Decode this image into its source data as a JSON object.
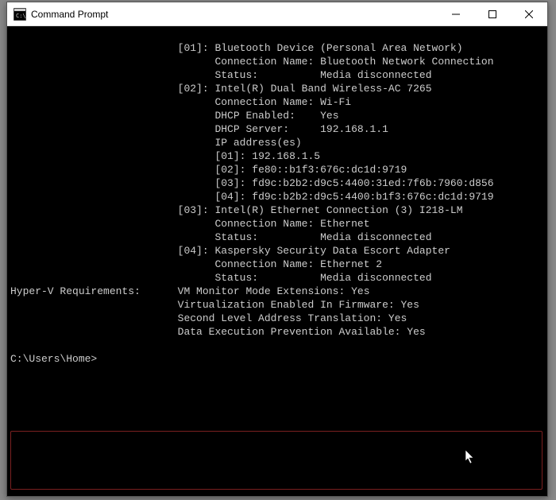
{
  "window": {
    "title": "Command Prompt"
  },
  "net01": {
    "label": "[01]:",
    "name": "Bluetooth Device (Personal Area Network)",
    "conn_label": "Connection Name:",
    "conn_value": "Bluetooth Network Connection",
    "status_label": "Status:",
    "status_value": "Media disconnected"
  },
  "net02": {
    "label": "[02]:",
    "name": "Intel(R) Dual Band Wireless-AC 7265",
    "conn_label": "Connection Name:",
    "conn_value": "Wi-Fi",
    "dhcp_enabled_label": "DHCP Enabled:",
    "dhcp_enabled_value": "Yes",
    "dhcp_server_label": "DHCP Server:",
    "dhcp_server_value": "192.168.1.1",
    "ip_label": "IP address(es)",
    "ip01_label": "[01]:",
    "ip01_value": "192.168.1.5",
    "ip02_label": "[02]:",
    "ip02_value": "fe80::b1f3:676c:dc1d:9719",
    "ip03_label": "[03]:",
    "ip03_value": "fd9c:b2b2:d9c5:4400:31ed:7f6b:7960:d856",
    "ip04_label": "[04]:",
    "ip04_value": "fd9c:b2b2:d9c5:4400:b1f3:676c:dc1d:9719"
  },
  "net03": {
    "label": "[03]:",
    "name": "Intel(R) Ethernet Connection (3) I218-LM",
    "conn_label": "Connection Name:",
    "conn_value": "Ethernet",
    "status_label": "Status:",
    "status_value": "Media disconnected"
  },
  "net04": {
    "label": "[04]:",
    "name": "Kaspersky Security Data Escort Adapter",
    "conn_label": "Connection Name:",
    "conn_value": "Ethernet 2",
    "status_label": "Status:",
    "status_value": "Media disconnected"
  },
  "hyperv": {
    "label": "Hyper-V Requirements:",
    "vm_label": "VM Monitor Mode Extensions:",
    "vm_value": "Yes",
    "virt_label": "Virtualization Enabled In Firmware:",
    "virt_value": "Yes",
    "slat_label": "Second Level Address Translation:",
    "slat_value": "Yes",
    "dep_label": "Data Execution Prevention Available:",
    "dep_value": "Yes"
  },
  "prompt": "C:\\Users\\Home>"
}
